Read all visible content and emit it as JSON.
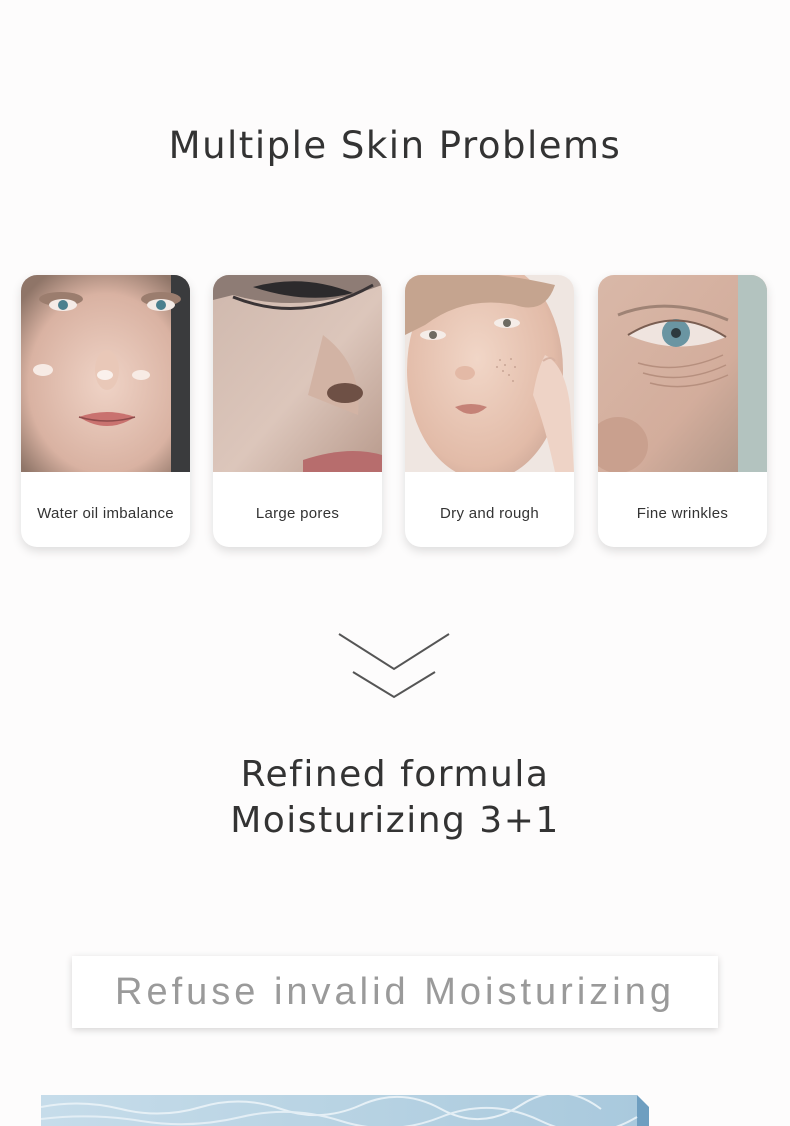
{
  "section_title": "Multiple Skin Problems",
  "cards": [
    {
      "label": "Water oil imbalance",
      "image": "oily-skin-face-photo"
    },
    {
      "label": "Large pores",
      "image": "large-pores-face-photo"
    },
    {
      "label": "Dry and rough",
      "image": "dry-skin-face-photo"
    },
    {
      "label": "Fine wrinkles",
      "image": "wrinkles-eye-photo"
    }
  ],
  "arrow_icon": "double-chevron-down-icon",
  "formula": {
    "line1": "Refined formula",
    "line2": "Moisturizing 3+1"
  },
  "banner_text": "Refuse invalid Moisturizing",
  "colors": {
    "background": "#fdfcfc",
    "text": "#333333",
    "banner_text": "#9a9a9a",
    "water": "#a9c9dd"
  }
}
